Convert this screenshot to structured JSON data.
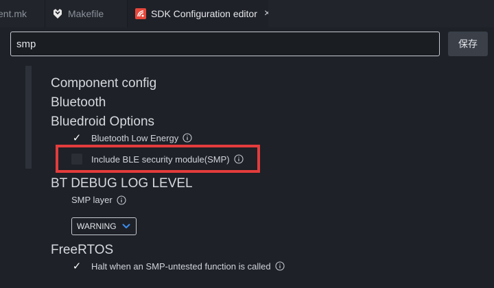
{
  "tabs": [
    {
      "label": "ent.mk"
    },
    {
      "label": "Makefile"
    },
    {
      "label": "SDK Configuration editor",
      "close": "×"
    }
  ],
  "search": {
    "value": "smp"
  },
  "toolbar": {
    "save_label": "保存"
  },
  "headings": {
    "component_config": "Component config",
    "bluetooth": "Bluetooth",
    "bluedroid_options": "Bluedroid Options",
    "bt_debug_log_level": "BT DEBUG LOG LEVEL",
    "freertos": "FreeRTOS"
  },
  "options": {
    "ble": {
      "label": "Bluetooth Low Energy",
      "checked": true
    },
    "smp_module": {
      "label": "Include BLE security module(SMP)",
      "checked": false
    },
    "halt": {
      "label": "Halt when an SMP-untested function is called",
      "checked": true
    }
  },
  "smp_layer": {
    "label": "SMP layer",
    "selected": "WARNING"
  },
  "icons": {
    "check": "✓",
    "info": "info-circle-icon",
    "chevron": "chevron-down-icon"
  },
  "colors": {
    "highlight": "#e43c3c",
    "chevron": "#3d8ef0"
  }
}
